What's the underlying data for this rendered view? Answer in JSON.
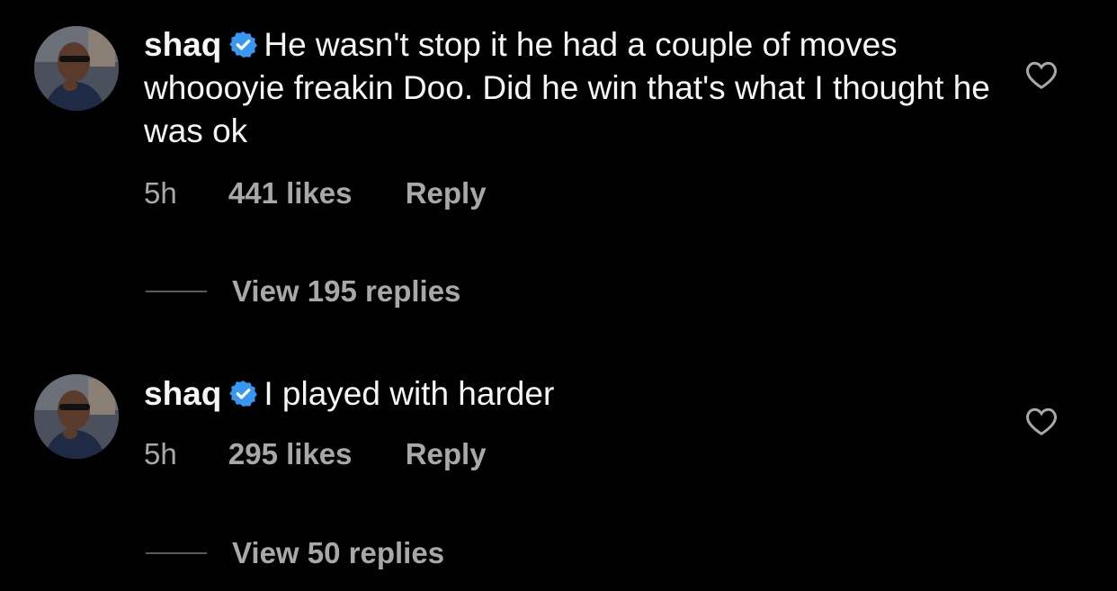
{
  "comments": [
    {
      "username": "shaq",
      "verified": true,
      "text": "He wasn't stop it he had a couple of moves whoooyie freakin Doo.  Did he win that's what I thought he was ok",
      "time": "5h",
      "likes": "441 likes",
      "reply_label": "Reply",
      "view_replies": "View 195 replies"
    },
    {
      "username": "shaq",
      "verified": true,
      "text": "I played with harder",
      "time": "5h",
      "likes": "295 likes",
      "reply_label": "Reply",
      "view_replies": "View 50 replies"
    }
  ],
  "colors": {
    "background": "#000000",
    "primary_text": "#f5f5f5",
    "secondary_text": "#a8a8a8",
    "verified_badge": "#3897f0",
    "divider": "#5a5a5a"
  },
  "icons": {
    "verified": "verified-badge-icon",
    "like": "heart-outline-icon"
  }
}
